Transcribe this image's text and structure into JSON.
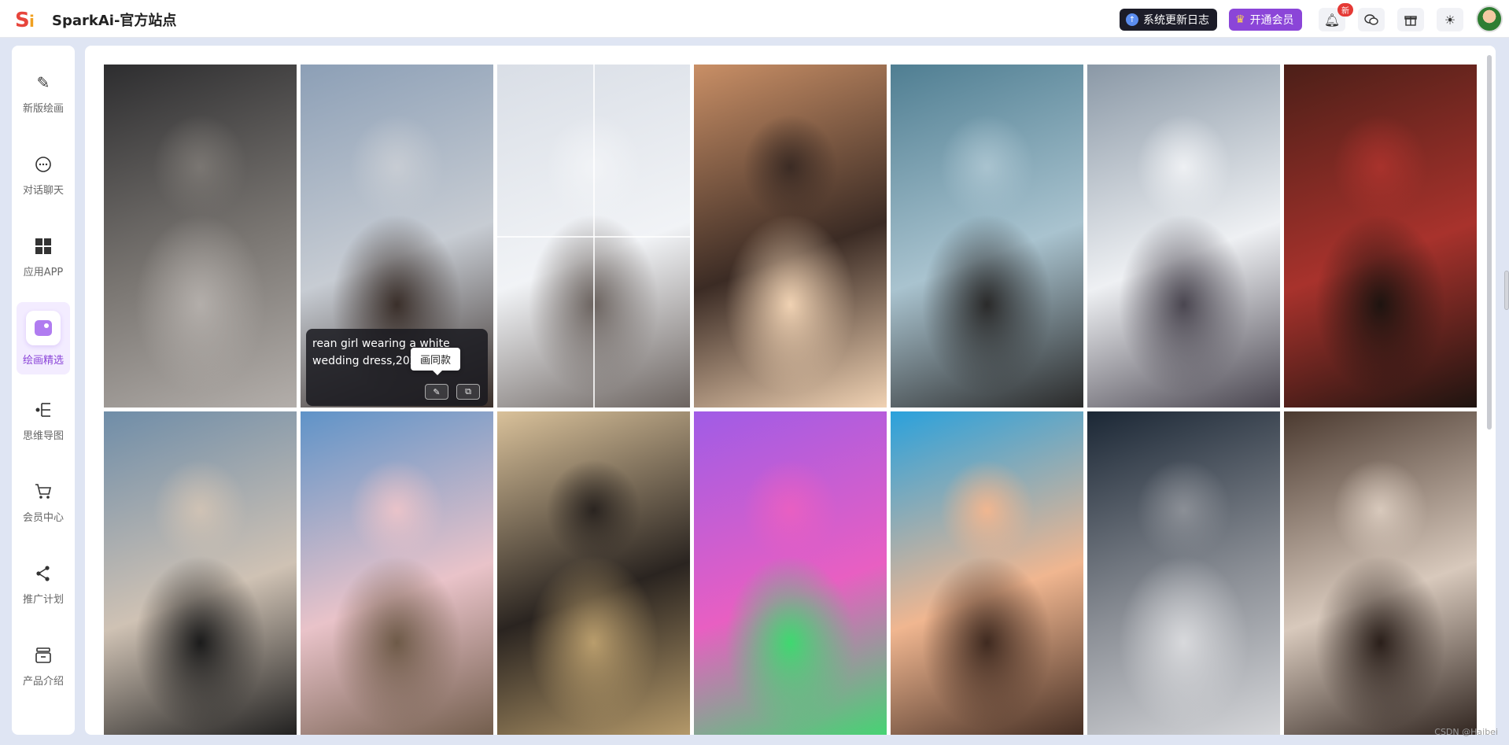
{
  "header": {
    "app_title": "SparkAi-官方站点",
    "logo_text": "Si",
    "changelog_label": "系统更新日志",
    "vip_label": "开通会员",
    "new_badge": "新",
    "icons": [
      "bell-icon",
      "wechat-icon",
      "gift-icon",
      "sun-icon"
    ]
  },
  "sidebar": {
    "items": [
      {
        "label": "新版绘画",
        "icon": "brush-icon"
      },
      {
        "label": "对话聊天",
        "icon": "chat-icon"
      },
      {
        "label": "应用APP",
        "icon": "grid-icon"
      },
      {
        "label": "绘画精选",
        "icon": "gallery-icon",
        "active": true
      },
      {
        "label": "思维导图",
        "icon": "mindmap-icon"
      },
      {
        "label": "会员中心",
        "icon": "cart-icon"
      },
      {
        "label": "推广计划",
        "icon": "share-icon"
      },
      {
        "label": "产品介绍",
        "icon": "product-icon"
      }
    ]
  },
  "gallery": {
    "prompt_preview": "rean girl wearing a white wedding dress,202",
    "tooltip": "画同款",
    "rows": [
      [
        {
          "name": "girl-black-dress-shadow",
          "colors": [
            "#2d2d2f",
            "#7a7672",
            "#b3aeaa"
          ]
        },
        {
          "name": "girl-white-hair-flying",
          "colors": [
            "#8c9fb6",
            "#c7ccd3",
            "#3a2f2a"
          ]
        },
        {
          "name": "wedding-collage",
          "colors": [
            "#d9dee6",
            "#f1f3f6",
            "#6c6460"
          ]
        },
        {
          "name": "girl-sunset-portrait",
          "colors": [
            "#c98f66",
            "#3b2b24",
            "#f0d2b3"
          ]
        },
        {
          "name": "girl-sea-sky",
          "colors": [
            "#4f7e92",
            "#a9c3cf",
            "#2a2a2a"
          ]
        },
        {
          "name": "girl-white-gown",
          "colors": [
            "#8a98a6",
            "#eef0f3",
            "#4a4650"
          ]
        },
        {
          "name": "girl-red-dress-christmas",
          "colors": [
            "#4c1f18",
            "#a8322c",
            "#1e1410"
          ]
        }
      ],
      [
        {
          "name": "girl-beach-bikini",
          "colors": [
            "#6f8da8",
            "#cfc2b4",
            "#1b1b1b"
          ]
        },
        {
          "name": "anime-girl-umbrella",
          "colors": [
            "#5f93c8",
            "#e9c3c9",
            "#6e5a48"
          ]
        },
        {
          "name": "witch-black-dress",
          "colors": [
            "#d9c19a",
            "#2a2420",
            "#b99d6c"
          ]
        },
        {
          "name": "3d-girl-purple-hair",
          "colors": [
            "#a05ce6",
            "#e85fc2",
            "#3fd870"
          ]
        },
        {
          "name": "3d-girl-ice-cream",
          "colors": [
            "#2aa1dc",
            "#f0b690",
            "#3f2a20"
          ]
        },
        {
          "name": "astronaut-moon",
          "colors": [
            "#1b2735",
            "#8b8f96",
            "#d8d9dc"
          ]
        },
        {
          "name": "girl-window-white-dress",
          "colors": [
            "#4b3a30",
            "#d8c9bc",
            "#2a1f1a"
          ]
        }
      ]
    ]
  },
  "watermark": "CSDN @Haibei"
}
